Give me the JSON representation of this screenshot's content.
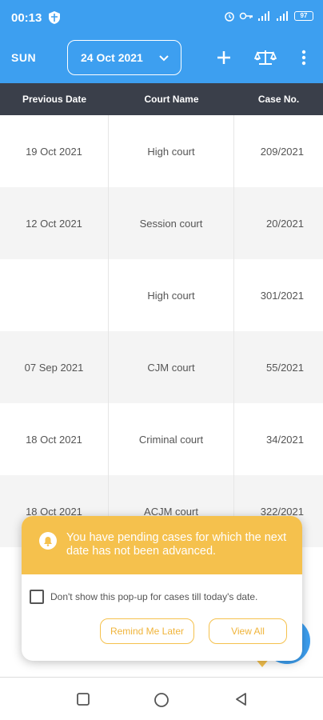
{
  "status_bar": {
    "time": "00:13",
    "battery": "97",
    "icons": [
      "shield-icon",
      "alarm-icon",
      "key-icon",
      "signal-icon",
      "wifi-signal-icon",
      "battery-icon"
    ]
  },
  "toolbar": {
    "day": "SUN",
    "date": "24 Oct 2021",
    "icons": [
      "plus-icon",
      "scales-icon",
      "more-vertical-icon"
    ],
    "bg_color": "#3d9ff0"
  },
  "table": {
    "headers": [
      "Previous Date",
      "Court Name",
      "Case No."
    ],
    "rows": [
      {
        "prev_date": "19 Oct 2021",
        "court": "High court",
        "case_no": "209/2021"
      },
      {
        "prev_date": "12 Oct 2021",
        "court": "Session court",
        "case_no": "20/2021"
      },
      {
        "prev_date": "",
        "court": "High court",
        "case_no": "301/2021"
      },
      {
        "prev_date": "07 Sep 2021",
        "court": "CJM court",
        "case_no": "55/2021"
      },
      {
        "prev_date": "18 Oct 2021",
        "court": "Criminal court",
        "case_no": "34/2021"
      },
      {
        "prev_date": "18 Oct 2021",
        "court": "ACJM court",
        "case_no": "322/2021"
      }
    ]
  },
  "popup": {
    "message": "You have pending cases for which the next date has not been advanced.",
    "checkbox_label": "Don't show this pop-up for cases till today's date.",
    "remind_label": "Remind Me Later",
    "view_all_label": "View All",
    "accent_color": "#f5c14d"
  },
  "nav": {
    "icons": [
      "recent-apps-icon",
      "home-icon",
      "back-icon"
    ]
  }
}
